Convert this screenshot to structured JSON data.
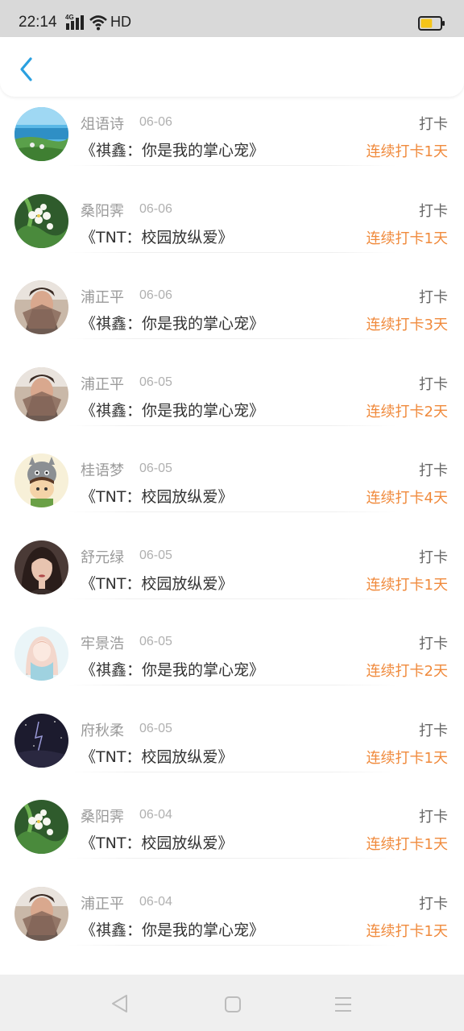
{
  "status_bar": {
    "time": "22:14",
    "network": "4G",
    "hd": "HD",
    "battery_level": 0.6,
    "battery_color": "#f5c518"
  },
  "header": {
    "back_icon": "chevron-left-icon",
    "accent": "#2aa0e0"
  },
  "items": [
    {
      "name": "俎语诗",
      "date": "06-06",
      "title": "《祺鑫：你是我的掌心宠》",
      "action": "打卡",
      "streak": "连续打卡1天",
      "avatar": "landscape-sea-avatar"
    },
    {
      "name": "桑阳霁",
      "date": "06-06",
      "title": "《TNT：校园放纵爱》",
      "action": "打卡",
      "streak": "连续打卡1天",
      "avatar": "white-flowers-avatar"
    },
    {
      "name": "浦正平",
      "date": "06-06",
      "title": "《祺鑫：你是我的掌心宠》",
      "action": "打卡",
      "streak": "连续打卡3天",
      "avatar": "person-fan-avatar"
    },
    {
      "name": "浦正平",
      "date": "06-05",
      "title": "《祺鑫：你是我的掌心宠》",
      "action": "打卡",
      "streak": "连续打卡2天",
      "avatar": "person-fan-avatar"
    },
    {
      "name": "桂语梦",
      "date": "06-05",
      "title": "《TNT：校园放纵爱》",
      "action": "打卡",
      "streak": "连续打卡4天",
      "avatar": "cartoon-totoro-avatar"
    },
    {
      "name": "舒元绿",
      "date": "06-05",
      "title": "《TNT：校园放纵爱》",
      "action": "打卡",
      "streak": "连续打卡1天",
      "avatar": "woman-portrait-avatar"
    },
    {
      "name": "牢景浩",
      "date": "06-05",
      "title": "《祺鑫：你是我的掌心宠》",
      "action": "打卡",
      "streak": "连续打卡2天",
      "avatar": "girl-illustration-avatar"
    },
    {
      "name": "府秋柔",
      "date": "06-05",
      "title": "《TNT：校园放纵爱》",
      "action": "打卡",
      "streak": "连续打卡1天",
      "avatar": "dark-night-avatar"
    },
    {
      "name": "桑阳霁",
      "date": "06-04",
      "title": "《TNT：校园放纵爱》",
      "action": "打卡",
      "streak": "连续打卡1天",
      "avatar": "white-flowers-avatar"
    },
    {
      "name": "浦正平",
      "date": "06-04",
      "title": "《祺鑫：你是我的掌心宠》",
      "action": "打卡",
      "streak": "连续打卡1天",
      "avatar": "person-fan-avatar"
    }
  ],
  "nav_bar": {
    "back_icon": "nav-back-icon",
    "home_icon": "nav-home-icon",
    "menu_icon": "nav-menu-icon"
  }
}
